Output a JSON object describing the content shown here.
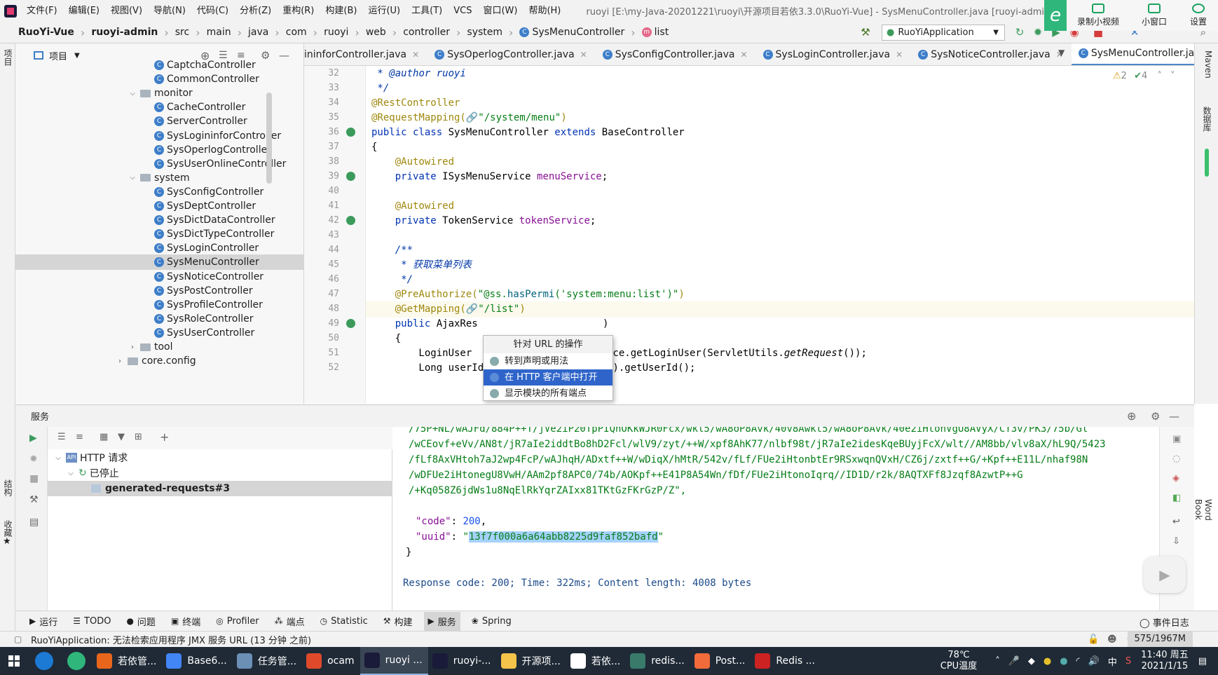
{
  "menubar": {
    "items": [
      "文件(F)",
      "编辑(E)",
      "视图(V)",
      "导航(N)",
      "代码(C)",
      "分析(Z)",
      "重构(R)",
      "构建(B)",
      "运行(U)",
      "工具(T)",
      "VCS",
      "窗口(W)",
      "帮助(H)"
    ],
    "window_title": "ruoyi [E:\\my-Java-20201221\\ruoyi\\开源项目若依3.3.0\\RuoYi-Vue] - SysMenuController.java [ruoyi-admin]",
    "right_apps": [
      "录制小视频",
      "小窗口",
      "设置"
    ]
  },
  "breadcrumb": [
    "RuoYi-Vue",
    "ruoyi-admin",
    "src",
    "main",
    "java",
    "com",
    "ruoyi",
    "web",
    "controller",
    "system",
    "SysMenuController",
    "list"
  ],
  "run_config": "RuoYiApplication",
  "project_panel": {
    "title": "项目",
    "tree": [
      {
        "label": "CaptchaController",
        "type": "class",
        "indent": 2
      },
      {
        "label": "CommonController",
        "type": "class",
        "indent": 2
      },
      {
        "label": "monitor",
        "type": "folder",
        "indent": 1,
        "expanded": true
      },
      {
        "label": "CacheController",
        "type": "class",
        "indent": 2
      },
      {
        "label": "ServerController",
        "type": "class",
        "indent": 2
      },
      {
        "label": "SysLogininforController",
        "type": "class",
        "indent": 2
      },
      {
        "label": "SysOperlogController",
        "type": "class",
        "indent": 2
      },
      {
        "label": "SysUserOnlineController",
        "type": "class",
        "indent": 2
      },
      {
        "label": "system",
        "type": "folder",
        "indent": 1,
        "expanded": true
      },
      {
        "label": "SysConfigController",
        "type": "class",
        "indent": 2
      },
      {
        "label": "SysDeptController",
        "type": "class",
        "indent": 2
      },
      {
        "label": "SysDictDataController",
        "type": "class",
        "indent": 2
      },
      {
        "label": "SysDictTypeController",
        "type": "class",
        "indent": 2
      },
      {
        "label": "SysLoginController",
        "type": "class",
        "indent": 2
      },
      {
        "label": "SysMenuController",
        "type": "class",
        "indent": 2,
        "selected": true
      },
      {
        "label": "SysNoticeController",
        "type": "class",
        "indent": 2
      },
      {
        "label": "SysPostController",
        "type": "class",
        "indent": 2
      },
      {
        "label": "SysProfileController",
        "type": "class",
        "indent": 2
      },
      {
        "label": "SysRoleController",
        "type": "class",
        "indent": 2
      },
      {
        "label": "SysUserController",
        "type": "class",
        "indent": 2
      },
      {
        "label": "tool",
        "type": "folder",
        "indent": 1,
        "expanded": false
      },
      {
        "label": "core.config",
        "type": "folder",
        "indent": 0,
        "expanded": false
      }
    ]
  },
  "editor_tabs": [
    {
      "label": "ininforController.java",
      "active": false
    },
    {
      "label": "SysOperlogController.java",
      "active": false
    },
    {
      "label": "SysConfigController.java",
      "active": false
    },
    {
      "label": "SysLoginController.java",
      "active": false
    },
    {
      "label": "SysNoticeController.java",
      "active": false
    },
    {
      "label": "SysMenuController.java",
      "active": true
    }
  ],
  "inspections": {
    "warnings": "2",
    "ok": "4"
  },
  "code_lines": [
    {
      "n": "32"
    },
    {
      "n": "33"
    },
    {
      "n": "34"
    },
    {
      "n": "35"
    },
    {
      "n": "36",
      "gutter": true
    },
    {
      "n": "37"
    },
    {
      "n": "38"
    },
    {
      "n": "39",
      "gutter": true
    },
    {
      "n": "40"
    },
    {
      "n": "41"
    },
    {
      "n": "42",
      "gutter": true
    },
    {
      "n": "43"
    },
    {
      "n": "44"
    },
    {
      "n": "45"
    },
    {
      "n": "46"
    },
    {
      "n": "47"
    },
    {
      "n": "48"
    },
    {
      "n": "49",
      "gutter": true
    },
    {
      "n": "50"
    },
    {
      "n": "51"
    },
    {
      "n": "52"
    }
  ],
  "code": {
    "l32_a": " * ",
    "l32_b": "@author",
    "l32_c": " ruoyi",
    "l33": " */",
    "l34": "@RestController",
    "l35_a": "@RequestMapping(",
    "l35_b": "\"/system/menu\"",
    "l35_c": ")",
    "l36_a": "public class ",
    "l36_b": "SysMenuController ",
    "l36_c": "extends ",
    "l36_d": "BaseController",
    "l37": "{",
    "l38": "    @Autowired",
    "l39_a": "    private ",
    "l39_b": "ISysMenuService ",
    "l39_c": "menuService",
    "l39_d": ";",
    "l41": "    @Autowired",
    "l42_a": "    private ",
    "l42_b": "TokenService ",
    "l42_c": "tokenService",
    "l42_d": ";",
    "l44": "    /**",
    "l45": "     * 获取菜单列表",
    "l46": "     */",
    "l47_a": "    @PreAuthorize(",
    "l47_b": "\"@ss.",
    "l47_c": "hasPermi",
    "l47_d": "('system:menu:list')\"",
    "l47_e": ")",
    "l48_a": "    @GetMapping(",
    "l48_b": "\"/list\"",
    "l48_c": ")",
    "l49_a": "    public ",
    "l49_b": "AjaxRes",
    "l49_c": ")",
    "l50": "    {",
    "l51_a": "        LoginUser",
    "l51_b": "ice.getLoginUser(ServletUtils.",
    "l51_c": "getRequest",
    "l51_d": "());",
    "l52_a": "        Long userId",
    "l52_b": "().getUserId();"
  },
  "popup": {
    "header": "针对 URL 的操作",
    "items": [
      "转到声明或用法",
      "在 HTTP 客户端中打开",
      "显示模块的所有端点"
    ],
    "highlighted": 1
  },
  "services": {
    "title": "服务",
    "tree": [
      {
        "label": "HTTP 请求"
      },
      {
        "label": "已停止"
      },
      {
        "label": "generated-requests#3",
        "selected": true
      }
    ]
  },
  "response": {
    "lines": [
      "/75P+NL/wAJFd/884P++T/jVe2iP20TpPIQnOKkWJR0Fcx/wkl5/wA8oP8Avk/40v8Awkt5/wA8oP8Avk/40e2iHtonVgU8AVyX/CT3v/PK3/75b/Gl",
      "/wCEovf+eVv/AN8t/jR7aIe2iddtBo8hD2Fcl/wlV9/zyt/++W/xpf8AhK77/nlbf98t/jR7aIe2idesKqeBUyjFcX/wlt//AM8bb/vlv8aX/hL9Q/5423",
      "/fLf8AxVHtoh7aJ2wp4FcP/wAJhqH/ADxtf++W/wDiqX/hMtR/542v/fLf/FUe2iHtonbtEr9RSxwqnQVxH/CZ6j/zxtf++G/+Kpf++E11L/nhaf98N",
      "/wDFUe2iHtonegU8VwH/AAm2pf8APC0/74b/AOKpf++E41P8A54Wn/fDf/FUe2iHtonoIqrq//ID1D/r2k/8AQTXFf8Jzqf8AzwtP++G",
      "/+Kq058Z6jdWs1u8NqElRkYqrZAIxx81TKtGzFKrGzP/Z\","
    ],
    "code_key": "\"code\"",
    "code_val": "200",
    "uuid_key": "\"uuid\"",
    "uuid_val": "13f7f000a6a64abb8225d9faf852bafd",
    "close": "}",
    "summary": "Response code: 200; Time: 322ms; Content length: 4008 bytes"
  },
  "tool_tabs": [
    "运行",
    "TODO",
    "问题",
    "终端",
    "Profiler",
    "端点",
    "Statistic",
    "构建",
    "服务",
    "Spring"
  ],
  "tool_tabs_active": "服务",
  "event_log": "事件日志",
  "status": {
    "message": "RuoYiApplication: 无法检索应用程序 JMX 服务 URL (13 分钟 之前)",
    "memory": "575/1967M"
  },
  "left_strip": {
    "top": "项目",
    "mid": "结构",
    "bottom": "收藏"
  },
  "right_strip": {
    "top": "Maven",
    "mid": "数据库",
    "bottom": "Word Book"
  },
  "taskbar": {
    "apps": [
      {
        "label": "若依管...",
        "color": "#e8661c"
      },
      {
        "label": "Base6...",
        "color": "#4285f4"
      },
      {
        "label": "任务管...",
        "color": "#6b8fb5"
      },
      {
        "label": "ocam",
        "color": "#e04a2a"
      },
      {
        "label": "ruoyi ...",
        "color": "#1a1a3a",
        "active": true
      },
      {
        "label": "ruoyi-...",
        "color": "#1a1a3a"
      },
      {
        "label": "开源项...",
        "color": "#f5c24a"
      },
      {
        "label": "若依...",
        "color": "#ffffff"
      },
      {
        "label": "redis...",
        "color": "#3a7a6a"
      },
      {
        "label": "Post...",
        "color": "#f26b3a"
      },
      {
        "label": "Redis ...",
        "color": "#cc2222"
      }
    ],
    "cpu_temp": "78℃",
    "cpu_label": "CPU温度",
    "ime": "中",
    "time": "11:40 周五",
    "date": "2021/1/15"
  }
}
